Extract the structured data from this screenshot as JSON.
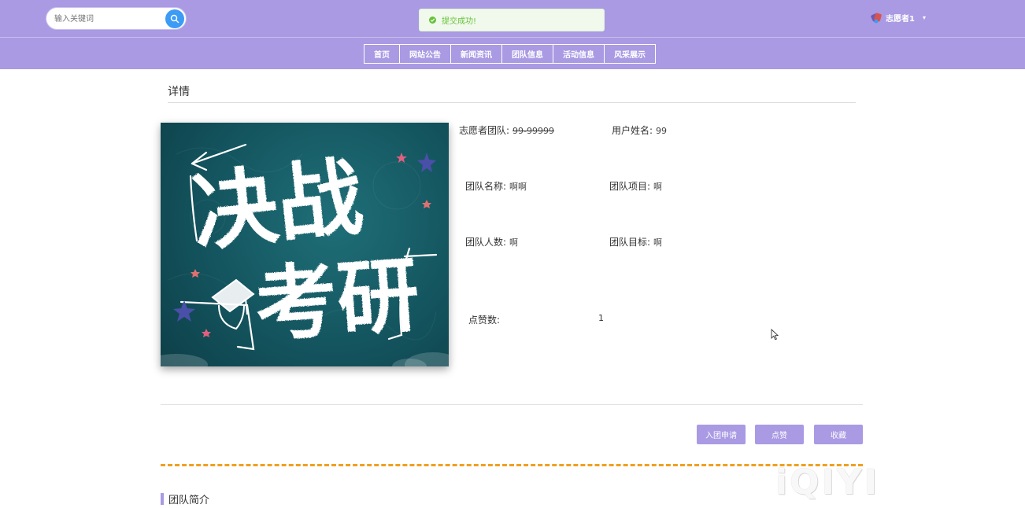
{
  "header": {
    "search_placeholder": "输入关键词",
    "toast_text": "提交成功!",
    "user_name": "志愿者1",
    "user_caret": "▾"
  },
  "nav": {
    "items": [
      "首页",
      "网站公告",
      "新闻资讯",
      "团队信息",
      "活动信息",
      "风采展示"
    ]
  },
  "detail": {
    "section_title": "详情",
    "volunteer_team_label": "志愿者团队:",
    "volunteer_team_value": "99-99999",
    "user_name_label": "用户姓名:",
    "user_name_value": "99",
    "team_name_label": "团队名称:",
    "team_name_value": "啊啊",
    "team_project_label": "团队项目:",
    "team_project_value": "啊",
    "team_size_label": "团队人数:",
    "team_size_value": "啊",
    "team_goal_label": "团队目标:",
    "team_goal_value": "啊",
    "likes_label": "点赞数:",
    "likes_value": "1"
  },
  "poster": {
    "line1": "决战",
    "line2": "考研"
  },
  "actions": {
    "join_label": "入团申请",
    "like_label": "点赞",
    "favorite_label": "收藏"
  },
  "intro": {
    "title": "团队简介"
  },
  "watermark": "iQIYI",
  "colors": {
    "brand": "#a99ae3",
    "search_button": "#3c9bf5",
    "success": "#67c23a",
    "dashed_divider": "#f0a020"
  }
}
